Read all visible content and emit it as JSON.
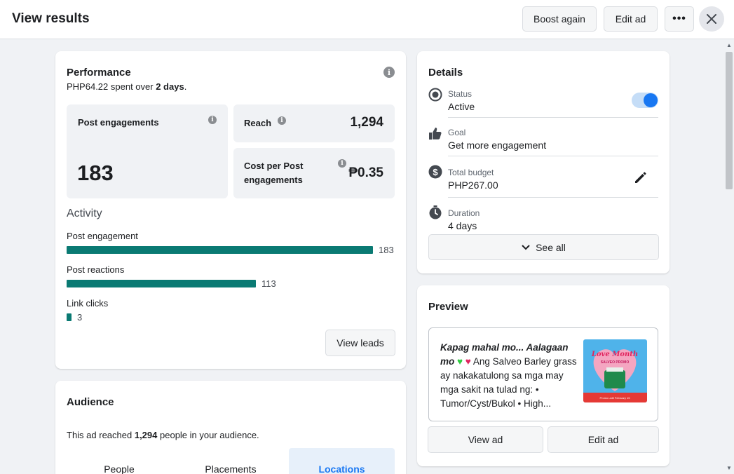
{
  "header": {
    "title": "View results",
    "boost_again": "Boost again",
    "edit_ad": "Edit ad",
    "more": "•••"
  },
  "performance": {
    "title": "Performance",
    "spent_amount": "PHP64.22",
    "spent_mid": " spent over ",
    "spent_days": "2 days",
    "spent_end": ".",
    "post_engagements_label": "Post engagements",
    "post_engagements_value": "183",
    "reach_label": "Reach",
    "reach_value": "1,294",
    "cost_label_1": "Cost per Post",
    "cost_label_2": "engagements",
    "cost_value": "₱0.35",
    "activity_title": "Activity",
    "activity": [
      {
        "label": "Post engagement",
        "value": "183",
        "fraction": 1.0
      },
      {
        "label": "Post reactions",
        "value": "113",
        "fraction": 0.6175
      },
      {
        "label": "Link clicks",
        "value": "3",
        "fraction": 0.016
      }
    ],
    "view_leads": "View leads"
  },
  "audience": {
    "title": "Audience",
    "text_pre": "This ad reached ",
    "text_num": "1,294",
    "text_post": " people in your audience.",
    "tabs": [
      "People",
      "Placements",
      "Locations"
    ],
    "active_tab": "Locations"
  },
  "details": {
    "title": "Details",
    "status_label": "Status",
    "status_value": "Active",
    "status_on": true,
    "goal_label": "Goal",
    "goal_value": "Get more engagement",
    "budget_label": "Total budget",
    "budget_value": "PHP267.00",
    "duration_label": "Duration",
    "duration_value": "4 days",
    "see_all": "See all"
  },
  "preview": {
    "title": "Preview",
    "text_lead": "Kapag mahal mo... Aalagaan mo",
    "text_body": " Ang Salveo Barley grass ay nakakatulong sa mga may mga sakit na tulad ng: • Tumor/Cyst/Bukol • High...",
    "image_title_1": "Love Month",
    "image_title_2": "SALVEO PROMO",
    "image_footer": "Promo until February 15",
    "view_ad": "View ad",
    "edit_ad": "Edit ad"
  },
  "colors": {
    "accent": "#1877f2",
    "bar": "#0a7a73"
  }
}
